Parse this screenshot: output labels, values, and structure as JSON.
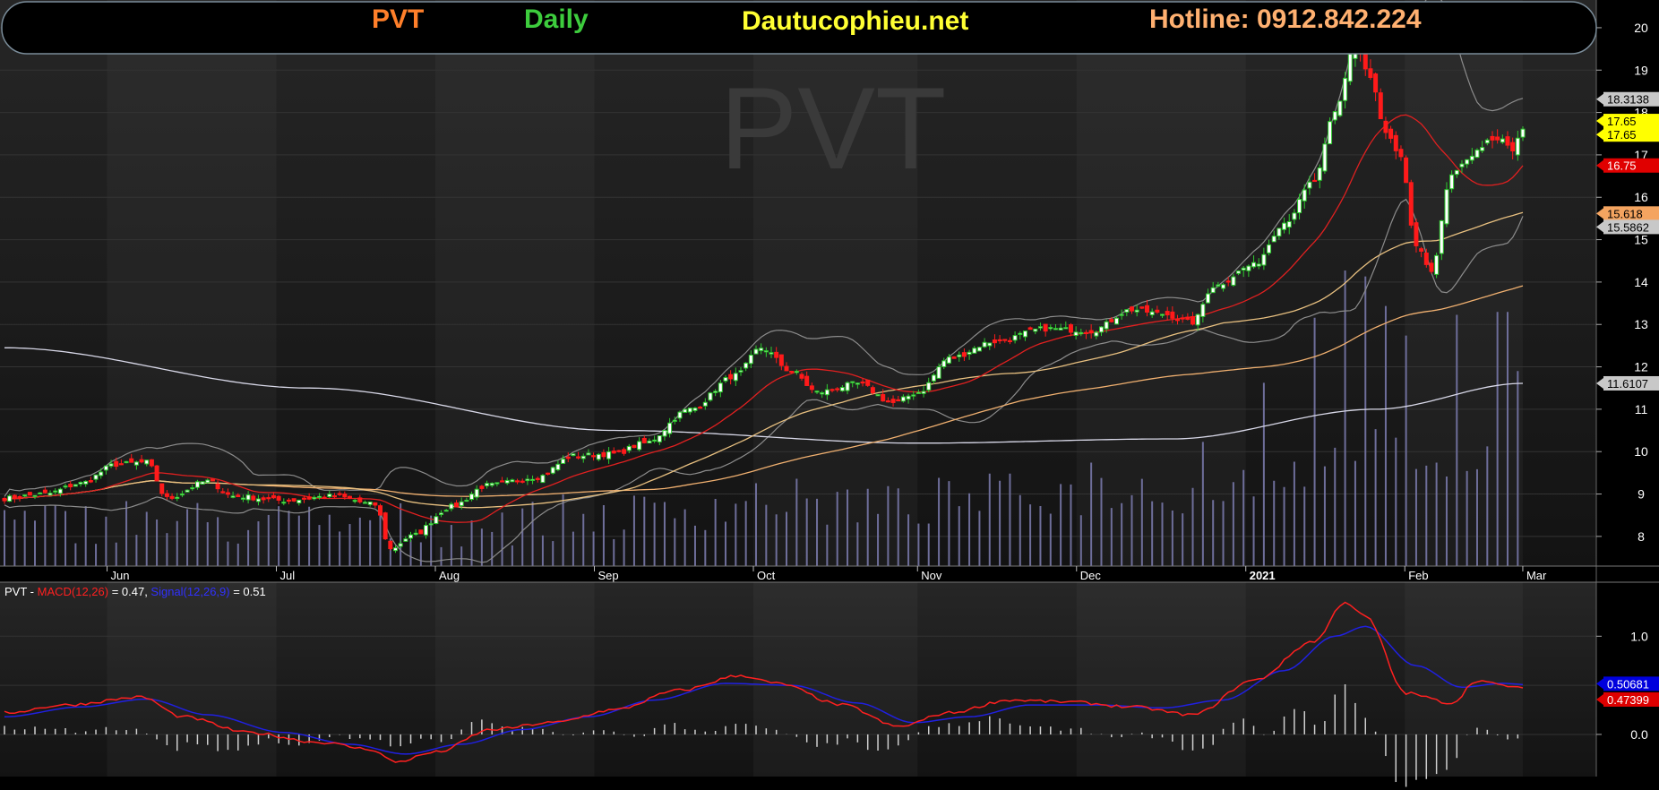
{
  "header": {
    "ticker": "PVT",
    "timeframe": "Daily",
    "site": "Dautucophieu.net",
    "hotline": "Hotline: 0912.842.224",
    "watermark": "PVT",
    "colors": {
      "ticker": "#ff7f2a",
      "timeframe": "#3dcc3d",
      "site": "#ffff33",
      "hotline": "#ffb070"
    }
  },
  "chart_data": {
    "type": "candlestick",
    "title": "PVT Daily",
    "x_labels": [
      "Jun",
      "Jul",
      "Aug",
      "Sep",
      "Oct",
      "Nov",
      "Dec",
      "2021",
      "Feb",
      "Mar"
    ],
    "x_label_days": [
      20,
      53,
      84,
      115,
      146,
      178,
      209,
      242,
      273,
      296
    ],
    "n_days": 297,
    "price_axis": {
      "ticks": [
        8,
        9,
        10,
        11,
        12,
        13,
        14,
        15,
        16,
        17,
        18,
        19,
        20
      ],
      "ylim": [
        7.3,
        20.4
      ]
    },
    "price_keypoints": [
      [
        0,
        8.9
      ],
      [
        8,
        9.0
      ],
      [
        15,
        9.25
      ],
      [
        22,
        9.7
      ],
      [
        28,
        9.75
      ],
      [
        32,
        8.9
      ],
      [
        40,
        9.3
      ],
      [
        45,
        8.95
      ],
      [
        55,
        8.85
      ],
      [
        65,
        8.95
      ],
      [
        73,
        8.75
      ],
      [
        76,
        7.7
      ],
      [
        80,
        8.0
      ],
      [
        88,
        8.7
      ],
      [
        95,
        9.2
      ],
      [
        105,
        9.4
      ],
      [
        112,
        9.9
      ],
      [
        120,
        9.95
      ],
      [
        126,
        10.2
      ],
      [
        135,
        11.0
      ],
      [
        144,
        11.8
      ],
      [
        149,
        12.45
      ],
      [
        155,
        11.9
      ],
      [
        160,
        11.4
      ],
      [
        168,
        11.6
      ],
      [
        175,
        11.15
      ],
      [
        180,
        11.4
      ],
      [
        186,
        12.2
      ],
      [
        195,
        12.6
      ],
      [
        205,
        12.9
      ],
      [
        214,
        12.85
      ],
      [
        222,
        13.35
      ],
      [
        228,
        13.25
      ],
      [
        234,
        13.05
      ],
      [
        238,
        13.9
      ],
      [
        246,
        14.4
      ],
      [
        252,
        15.4
      ],
      [
        258,
        16.4
      ],
      [
        262,
        18.0
      ],
      [
        266,
        19.65
      ],
      [
        269,
        18.8
      ],
      [
        272,
        17.5
      ],
      [
        275,
        16.9
      ],
      [
        278,
        14.8
      ],
      [
        281,
        14.3
      ],
      [
        285,
        16.5
      ],
      [
        289,
        17.0
      ],
      [
        292,
        17.3
      ],
      [
        295,
        17.35
      ],
      [
        297,
        17.1
      ],
      [
        299,
        17.6
      ]
    ],
    "ma_indicators": {
      "ma20_end": 16.75,
      "bb_upper_end": 18.3138,
      "ma50_end": 15.618,
      "bb_lower_end": 15.5862,
      "ma100_end": 13.9,
      "ma200_end": 11.6107
    },
    "price_badges": [
      {
        "text": "18.3138",
        "value": 18.3138,
        "bg": "#c8c8c8",
        "fg": "#000000"
      },
      {
        "text": "17.65",
        "value": 17.8,
        "bg": "#ffff00",
        "fg": "#000000"
      },
      {
        "text": "17.65",
        "value": 17.48,
        "bg": "#ffff00",
        "fg": "#000000"
      },
      {
        "text": "16.75",
        "value": 16.75,
        "bg": "#e00000",
        "fg": "#ffffff"
      },
      {
        "text": "15.618",
        "value": 15.618,
        "bg": "#f4a460",
        "fg": "#000000"
      },
      {
        "text": "15.5862",
        "value": 15.3,
        "bg": "#c8c8c8",
        "fg": "#000000"
      },
      {
        "text": "11.6107",
        "value": 11.6107,
        "bg": "#c8c8c8",
        "fg": "#000000"
      }
    ],
    "volume": {
      "max": 1.0,
      "spikes": [
        [
          212,
          0.35
        ],
        [
          233,
          0.42
        ],
        [
          246,
          0.62
        ],
        [
          255,
          0.84
        ],
        [
          262,
          1.0
        ],
        [
          266,
          0.98
        ],
        [
          270,
          0.88
        ],
        [
          274,
          0.78
        ],
        [
          283,
          0.85
        ],
        [
          292,
          0.86
        ],
        [
          296,
          0.66
        ]
      ]
    },
    "macd": {
      "legend_name": "PVT - ",
      "macd_label": "MACD(12,26)",
      "macd_value": " = 0.47, ",
      "signal_label": "Signal(12,26,9)",
      "signal_value": " = 0.51",
      "ticks": [
        0.0,
        0.5,
        1.0
      ],
      "tick_labels": [
        "0.0",
        "",
        "1.0"
      ],
      "ylim": [
        -0.42,
        1.55
      ],
      "macd_end": 0.4739,
      "signal_end": 0.50681,
      "macd_badge": "0.47399",
      "signal_badge": "0.50681",
      "macd_keypoints": [
        [
          0,
          0.22
        ],
        [
          12,
          0.3
        ],
        [
          27,
          0.38
        ],
        [
          35,
          0.18
        ],
        [
          48,
          0.02
        ],
        [
          62,
          -0.08
        ],
        [
          72,
          -0.15
        ],
        [
          77,
          -0.28
        ],
        [
          85,
          -0.18
        ],
        [
          96,
          0.05
        ],
        [
          108,
          0.12
        ],
        [
          120,
          0.25
        ],
        [
          133,
          0.45
        ],
        [
          145,
          0.6
        ],
        [
          152,
          0.52
        ],
        [
          165,
          0.3
        ],
        [
          176,
          0.08
        ],
        [
          186,
          0.22
        ],
        [
          198,
          0.35
        ],
        [
          210,
          0.33
        ],
        [
          222,
          0.28
        ],
        [
          234,
          0.2
        ],
        [
          246,
          0.55
        ],
        [
          258,
          0.95
        ],
        [
          264,
          1.35
        ],
        [
          268,
          1.2
        ],
        [
          276,
          0.42
        ],
        [
          285,
          0.32
        ],
        [
          290,
          0.55
        ],
        [
          295,
          0.5
        ],
        [
          299,
          0.47
        ]
      ],
      "signal_keypoints": [
        [
          0,
          0.18
        ],
        [
          15,
          0.28
        ],
        [
          28,
          0.36
        ],
        [
          40,
          0.2
        ],
        [
          55,
          0.02
        ],
        [
          68,
          -0.1
        ],
        [
          79,
          -0.2
        ],
        [
          90,
          -0.1
        ],
        [
          102,
          0.05
        ],
        [
          115,
          0.18
        ],
        [
          128,
          0.35
        ],
        [
          142,
          0.52
        ],
        [
          155,
          0.5
        ],
        [
          168,
          0.32
        ],
        [
          179,
          0.12
        ],
        [
          190,
          0.18
        ],
        [
          202,
          0.3
        ],
        [
          215,
          0.3
        ],
        [
          228,
          0.27
        ],
        [
          240,
          0.35
        ],
        [
          252,
          0.65
        ],
        [
          262,
          1.0
        ],
        [
          268,
          1.1
        ],
        [
          278,
          0.7
        ],
        [
          287,
          0.48
        ],
        [
          295,
          0.52
        ],
        [
          299,
          0.51
        ]
      ]
    }
  }
}
